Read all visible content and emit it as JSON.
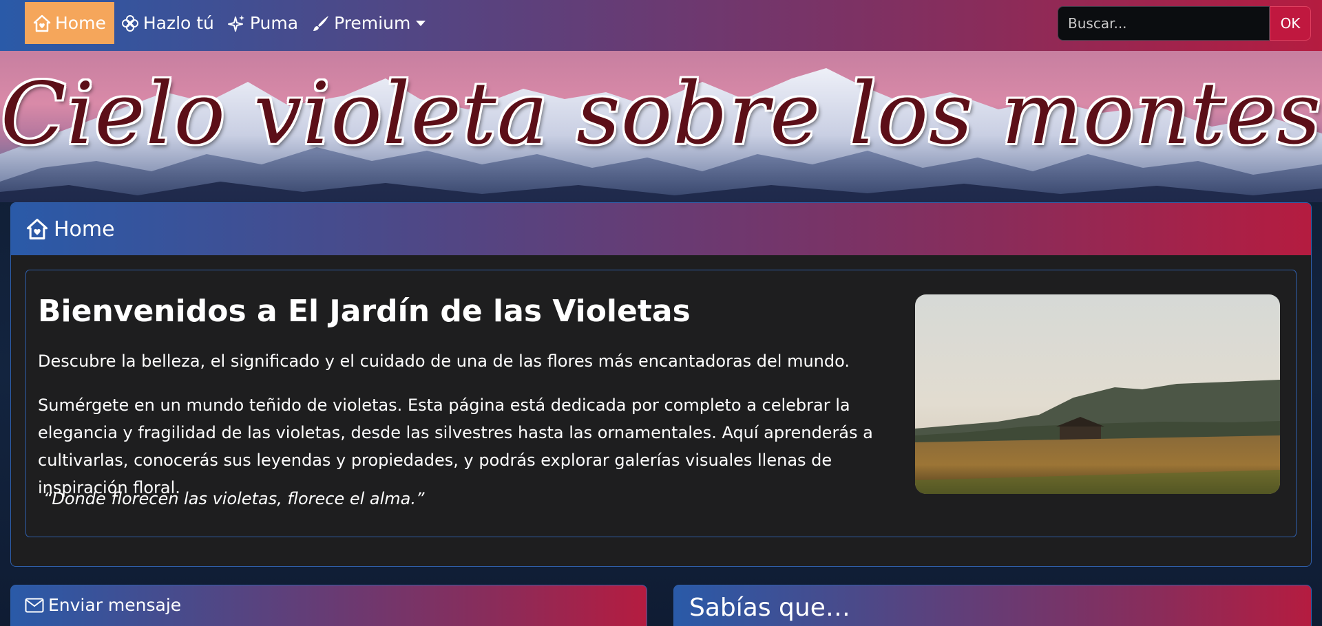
{
  "nav": {
    "items": [
      {
        "label": "Home",
        "icon": "home-icon",
        "active": true
      },
      {
        "label": "Hazlo tú",
        "icon": "flower-icon",
        "active": false
      },
      {
        "label": "Puma",
        "icon": "sparkles-icon",
        "active": false
      },
      {
        "label": "Premium",
        "icon": "brush-icon",
        "active": false,
        "dropdown": true
      }
    ],
    "search_placeholder": "Buscar...",
    "search_button": "OK"
  },
  "banner": {
    "title": "Cielo violeta sobre los montes"
  },
  "main_card": {
    "header": "Home",
    "header_icon": "home-icon",
    "heading": "Bienvenidos a El Jardín de las Violetas",
    "lead": "Descubre la belleza, el significado y el cuidado de una de las flores más encantadoras del mundo.",
    "body": "Sumérgete en un mundo teñido de violetas. Esta página está dedicada por completo a celebrar la elegancia y fragilidad de las violetas, desde las silvestres hasta las ornamentales. Aquí aprenderás a cultivarlas, conocerás sus leyendas y propiedades, y podrás explorar galerías visuales llenas de inspiración floral.",
    "quote": "“Donde florecen las violetas, florece el alma.”"
  },
  "bottom": {
    "left_label": "Enviar mensaje",
    "left_icon": "envelope-icon",
    "right_label": "Sabías que…"
  },
  "colors": {
    "accent_active": "#f5a65b",
    "gradient_start": "#2a5aa8",
    "gradient_end": "#b51c40",
    "button": "#c0183f",
    "card_bg": "#1e1e1f"
  }
}
